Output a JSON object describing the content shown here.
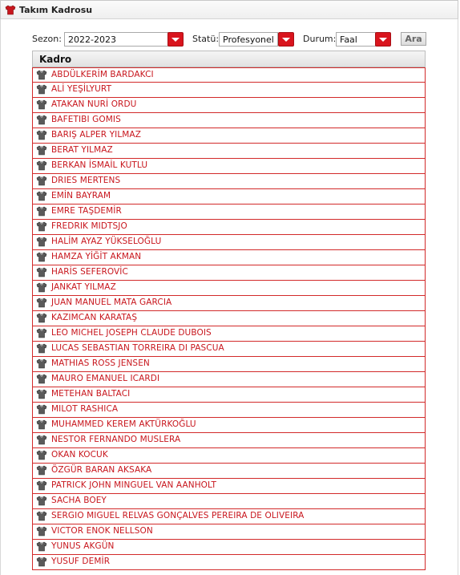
{
  "header": {
    "title": "Takım Kadrosu"
  },
  "filters": {
    "season_label": "Sezon:",
    "season_value": "2022-2023",
    "status_label": "Statü:",
    "status_value": "Profesyonel",
    "state_label": "Durum:",
    "state_value": "Faal",
    "search_button": "Ara"
  },
  "table": {
    "header": "Kadro",
    "players": [
      "ABDÜLKERİM BARDAKCI",
      "ALİ YEŞİLYURT",
      "ATAKAN NURİ ORDU",
      "BAFETIBI GOMIS",
      "BARIŞ ALPER YILMAZ",
      "BERAT YILMAZ",
      "BERKAN İSMAİL KUTLU",
      "DRIES MERTENS",
      "EMİN BAYRAM",
      "EMRE TAŞDEMİR",
      "FREDRIK MIDTSJO",
      "HALİM AYAZ YÜKSELOĞLU",
      "HAMZA YİĞİT AKMAN",
      "HARİS SEFEROVİC",
      "JANKAT YILMAZ",
      "JUAN MANUEL MATA GARCIA",
      "KAZIMCAN KARATAŞ",
      "LEO MICHEL JOSEPH CLAUDE DUBOIS",
      "LUCAS SEBASTIAN TORREIRA DI PASCUA",
      "MATHIAS ROSS JENSEN",
      "MAURO EMANUEL ICARDI",
      "METEHAN BALTACI",
      "MILOT RASHICA",
      "MUHAMMED KEREM AKTÜRKOĞLU",
      "NESTOR FERNANDO MUSLERA",
      "OKAN KOCUK",
      "ÖZGÜR BARAN AKSAKA",
      "PATRICK JOHN MINGUEL VAN AANHOLT",
      "SACHA BOEY",
      "SERGIO MIGUEL RELVAS GONÇALVES PEREIRA DE OLIVEIRA",
      "VICTOR ENOK NELLSON",
      "YUNUS AKGÜN",
      "YUSUF DEMİR"
    ]
  },
  "colors": {
    "accent": "#d9141d",
    "link": "#c8161d"
  },
  "icons": {
    "header": "team-icon",
    "row": "jersey-icon"
  }
}
